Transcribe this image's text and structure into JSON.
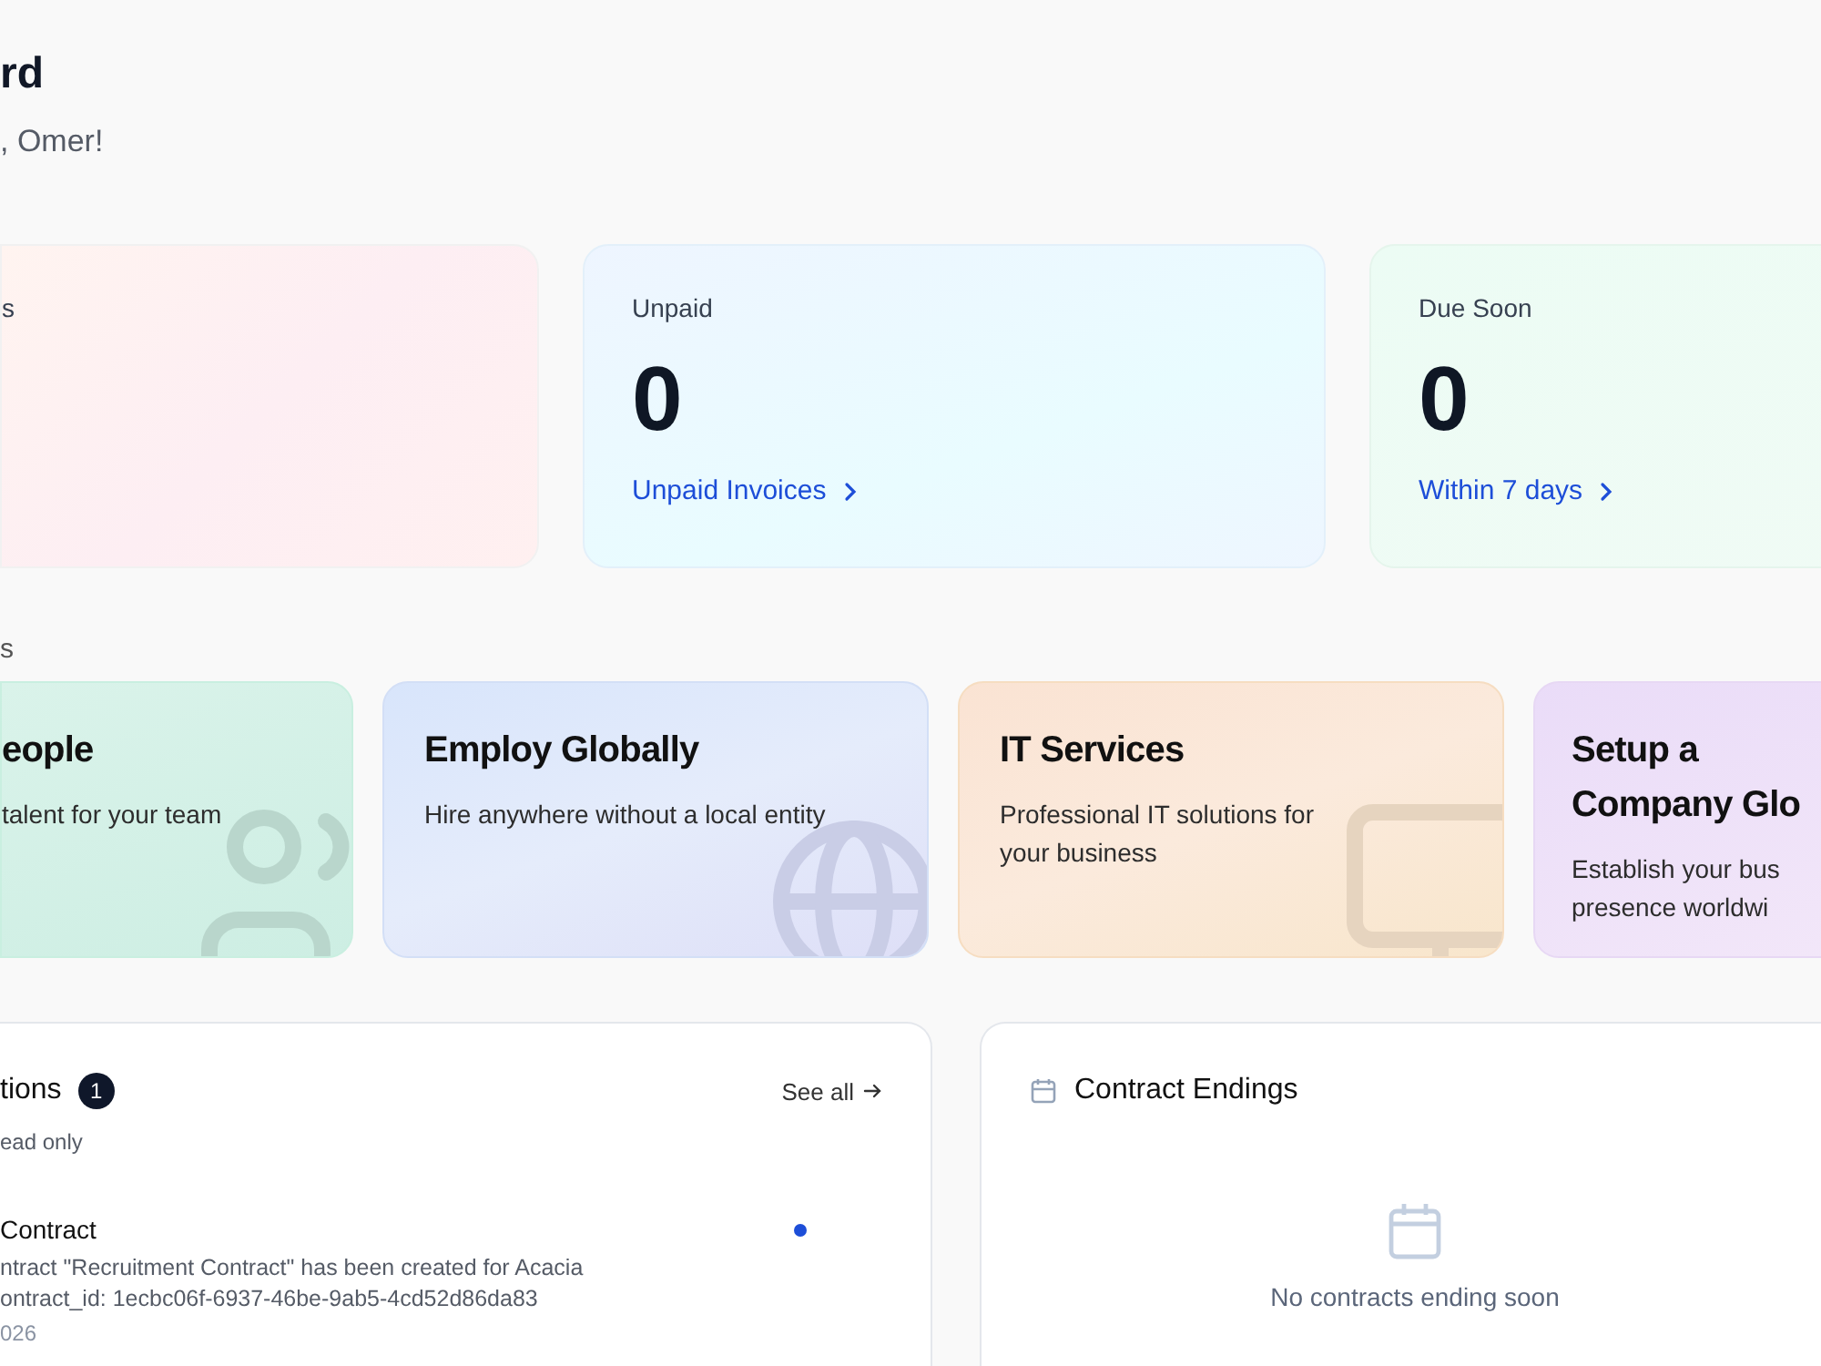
{
  "header": {
    "title": "rd",
    "subtitle": ", Omer!"
  },
  "stats": [
    {
      "label": "s"
    },
    {
      "label": "Unpaid",
      "value": "0",
      "link": "Unpaid Invoices"
    },
    {
      "label": "Due Soon",
      "value": "0",
      "link": "Within 7 days"
    }
  ],
  "services_heading": "s",
  "services": [
    {
      "kind": "people",
      "title": "eople",
      "description": "talent for your team"
    },
    {
      "kind": "globe",
      "title": "Employ Globally",
      "description": "Hire anywhere without a local entity"
    },
    {
      "kind": "monitor",
      "title": "IT Services",
      "description": "Professional IT solutions for your business"
    },
    {
      "kind": "company",
      "title": "Setup a Company Glo",
      "description": "Establish your bus presence worldwi"
    }
  ],
  "notifications": {
    "title": "tions",
    "badge": "1",
    "see_all": "See all",
    "filter": "ead only",
    "items": [
      {
        "title": "Contract",
        "message": "ntract \"Recruitment Contract\" has been created for Acacia",
        "detail": "ontract_id: 1ecbc06f-6937-46be-9ab5-4cd52d86da83",
        "date": "026",
        "unread": true
      }
    ]
  },
  "contract_endings": {
    "title": "Contract Endings",
    "empty": "No contracts ending soon"
  }
}
